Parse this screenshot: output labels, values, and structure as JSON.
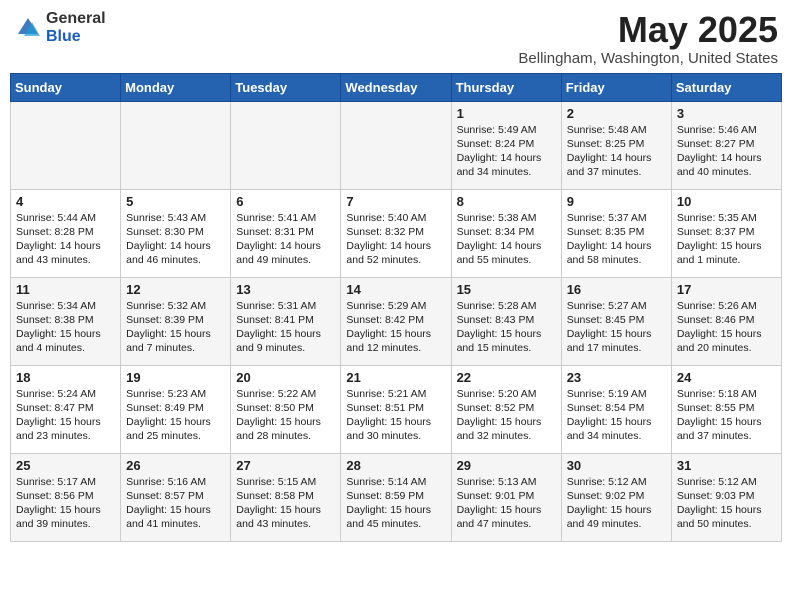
{
  "logo": {
    "general": "General",
    "blue": "Blue"
  },
  "title": "May 2025",
  "location": "Bellingham, Washington, United States",
  "days_header": [
    "Sunday",
    "Monday",
    "Tuesday",
    "Wednesday",
    "Thursday",
    "Friday",
    "Saturday"
  ],
  "weeks": [
    [
      {
        "day": "",
        "text": ""
      },
      {
        "day": "",
        "text": ""
      },
      {
        "day": "",
        "text": ""
      },
      {
        "day": "",
        "text": ""
      },
      {
        "day": "1",
        "text": "Sunrise: 5:49 AM\nSunset: 8:24 PM\nDaylight: 14 hours\nand 34 minutes."
      },
      {
        "day": "2",
        "text": "Sunrise: 5:48 AM\nSunset: 8:25 PM\nDaylight: 14 hours\nand 37 minutes."
      },
      {
        "day": "3",
        "text": "Sunrise: 5:46 AM\nSunset: 8:27 PM\nDaylight: 14 hours\nand 40 minutes."
      }
    ],
    [
      {
        "day": "4",
        "text": "Sunrise: 5:44 AM\nSunset: 8:28 PM\nDaylight: 14 hours\nand 43 minutes."
      },
      {
        "day": "5",
        "text": "Sunrise: 5:43 AM\nSunset: 8:30 PM\nDaylight: 14 hours\nand 46 minutes."
      },
      {
        "day": "6",
        "text": "Sunrise: 5:41 AM\nSunset: 8:31 PM\nDaylight: 14 hours\nand 49 minutes."
      },
      {
        "day": "7",
        "text": "Sunrise: 5:40 AM\nSunset: 8:32 PM\nDaylight: 14 hours\nand 52 minutes."
      },
      {
        "day": "8",
        "text": "Sunrise: 5:38 AM\nSunset: 8:34 PM\nDaylight: 14 hours\nand 55 minutes."
      },
      {
        "day": "9",
        "text": "Sunrise: 5:37 AM\nSunset: 8:35 PM\nDaylight: 14 hours\nand 58 minutes."
      },
      {
        "day": "10",
        "text": "Sunrise: 5:35 AM\nSunset: 8:37 PM\nDaylight: 15 hours\nand 1 minute."
      }
    ],
    [
      {
        "day": "11",
        "text": "Sunrise: 5:34 AM\nSunset: 8:38 PM\nDaylight: 15 hours\nand 4 minutes."
      },
      {
        "day": "12",
        "text": "Sunrise: 5:32 AM\nSunset: 8:39 PM\nDaylight: 15 hours\nand 7 minutes."
      },
      {
        "day": "13",
        "text": "Sunrise: 5:31 AM\nSunset: 8:41 PM\nDaylight: 15 hours\nand 9 minutes."
      },
      {
        "day": "14",
        "text": "Sunrise: 5:29 AM\nSunset: 8:42 PM\nDaylight: 15 hours\nand 12 minutes."
      },
      {
        "day": "15",
        "text": "Sunrise: 5:28 AM\nSunset: 8:43 PM\nDaylight: 15 hours\nand 15 minutes."
      },
      {
        "day": "16",
        "text": "Sunrise: 5:27 AM\nSunset: 8:45 PM\nDaylight: 15 hours\nand 17 minutes."
      },
      {
        "day": "17",
        "text": "Sunrise: 5:26 AM\nSunset: 8:46 PM\nDaylight: 15 hours\nand 20 minutes."
      }
    ],
    [
      {
        "day": "18",
        "text": "Sunrise: 5:24 AM\nSunset: 8:47 PM\nDaylight: 15 hours\nand 23 minutes."
      },
      {
        "day": "19",
        "text": "Sunrise: 5:23 AM\nSunset: 8:49 PM\nDaylight: 15 hours\nand 25 minutes."
      },
      {
        "day": "20",
        "text": "Sunrise: 5:22 AM\nSunset: 8:50 PM\nDaylight: 15 hours\nand 28 minutes."
      },
      {
        "day": "21",
        "text": "Sunrise: 5:21 AM\nSunset: 8:51 PM\nDaylight: 15 hours\nand 30 minutes."
      },
      {
        "day": "22",
        "text": "Sunrise: 5:20 AM\nSunset: 8:52 PM\nDaylight: 15 hours\nand 32 minutes."
      },
      {
        "day": "23",
        "text": "Sunrise: 5:19 AM\nSunset: 8:54 PM\nDaylight: 15 hours\nand 34 minutes."
      },
      {
        "day": "24",
        "text": "Sunrise: 5:18 AM\nSunset: 8:55 PM\nDaylight: 15 hours\nand 37 minutes."
      }
    ],
    [
      {
        "day": "25",
        "text": "Sunrise: 5:17 AM\nSunset: 8:56 PM\nDaylight: 15 hours\nand 39 minutes."
      },
      {
        "day": "26",
        "text": "Sunrise: 5:16 AM\nSunset: 8:57 PM\nDaylight: 15 hours\nand 41 minutes."
      },
      {
        "day": "27",
        "text": "Sunrise: 5:15 AM\nSunset: 8:58 PM\nDaylight: 15 hours\nand 43 minutes."
      },
      {
        "day": "28",
        "text": "Sunrise: 5:14 AM\nSunset: 8:59 PM\nDaylight: 15 hours\nand 45 minutes."
      },
      {
        "day": "29",
        "text": "Sunrise: 5:13 AM\nSunset: 9:01 PM\nDaylight: 15 hours\nand 47 minutes."
      },
      {
        "day": "30",
        "text": "Sunrise: 5:12 AM\nSunset: 9:02 PM\nDaylight: 15 hours\nand 49 minutes."
      },
      {
        "day": "31",
        "text": "Sunrise: 5:12 AM\nSunset: 9:03 PM\nDaylight: 15 hours\nand 50 minutes."
      }
    ]
  ]
}
